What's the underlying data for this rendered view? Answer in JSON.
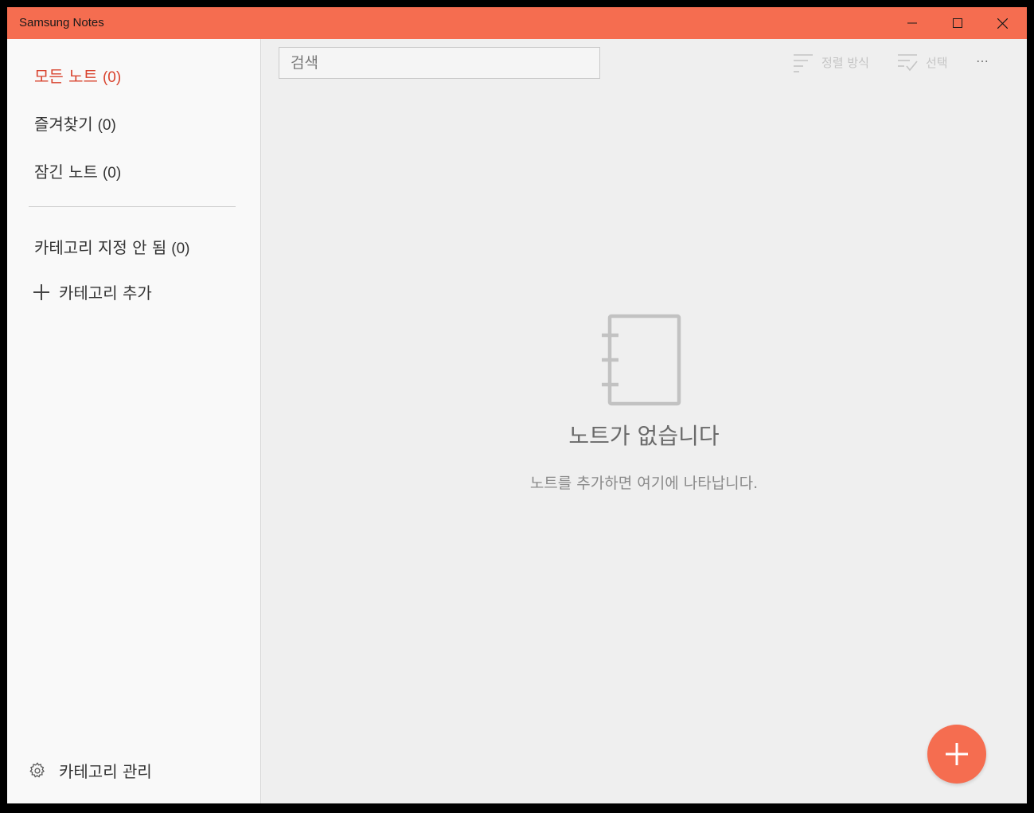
{
  "window": {
    "title": "Samsung Notes"
  },
  "titlebar_buttons": {
    "minimize_icon": "minimize-icon",
    "maximize_icon": "maximize-icon",
    "close_icon": "close-icon"
  },
  "sidebar": {
    "all_notes": {
      "label": "모든 노트",
      "count": "(0)"
    },
    "favorites": {
      "label": "즐겨찾기",
      "count": "(0)"
    },
    "locked_notes": {
      "label": "잠긴 노트",
      "count": "(0)"
    },
    "uncategorized": {
      "label": "카테고리 지정 안 됨",
      "count": "(0)"
    },
    "add_category": {
      "label": "카테고리 추가",
      "icon": "plus-icon"
    },
    "manage_categories": {
      "label": "카테고리 관리",
      "icon": "gear-icon"
    }
  },
  "toolbar": {
    "search_placeholder": "검색",
    "sort_label": "정렬 방식",
    "select_label": "선택",
    "more_icon": "more-icon"
  },
  "empty_state": {
    "title": "노트가 없습니다",
    "subtitle": "노트를 추가하면 여기에 나타납니다.",
    "icon": "notebook-icon"
  },
  "fab": {
    "icon": "plus-icon"
  },
  "colors": {
    "accent": "#f56d50",
    "active_text": "#d9442f",
    "sidebar_bg": "#f9f9f9",
    "main_bg": "#efefef",
    "disabled_tool": "#c4c4c4"
  }
}
